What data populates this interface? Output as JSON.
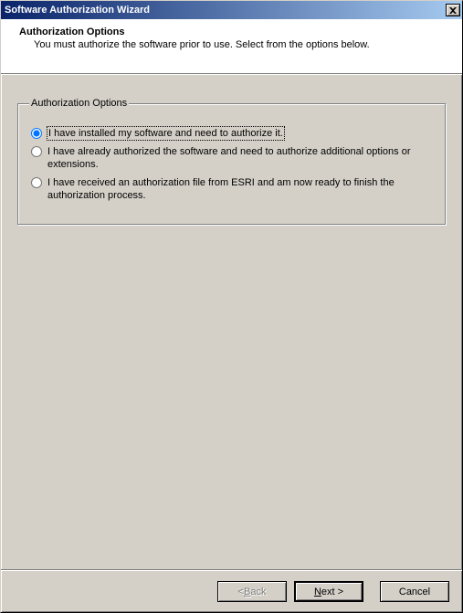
{
  "titlebar": {
    "title": "Software Authorization Wizard",
    "close_label": "Close"
  },
  "header": {
    "title": "Authorization Options",
    "subtitle": "You must authorize the software prior to use. Select from the options below."
  },
  "group": {
    "legend": "Authorization Options",
    "options": [
      {
        "label": "I have installed my software and need to authorize it.",
        "checked": true
      },
      {
        "label": "I have already authorized the software and need to authorize additional options or extensions.",
        "checked": false
      },
      {
        "label": "I have received an authorization file from ESRI and am now ready to finish the authorization process.",
        "checked": false
      }
    ]
  },
  "buttons": {
    "back_prefix": "< ",
    "back_accel": "B",
    "back_suffix": "ack",
    "next_accel": "N",
    "next_suffix": "ext >",
    "cancel": "Cancel"
  }
}
